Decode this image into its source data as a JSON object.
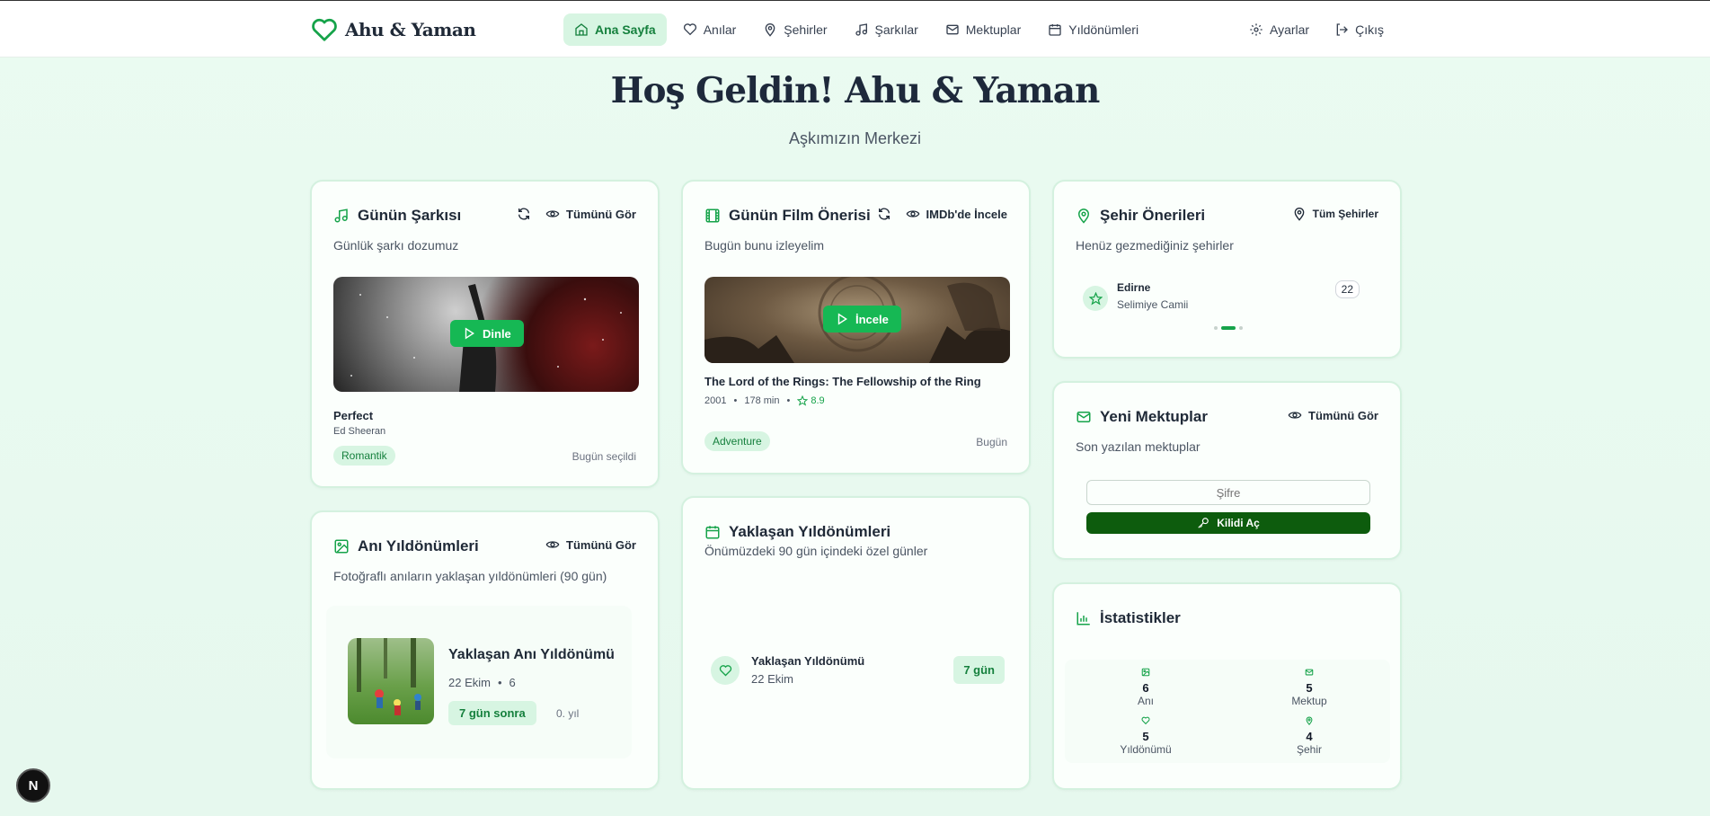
{
  "brand": {
    "name": "Ahu & Yaman",
    "icon": "heart-icon"
  },
  "nav": {
    "links": [
      {
        "label": "Ana Sayfa",
        "icon": "home-icon",
        "active": true
      },
      {
        "label": "Anılar",
        "icon": "heart-icon"
      },
      {
        "label": "Şehirler",
        "icon": "map-pin-icon"
      },
      {
        "label": "Şarkılar",
        "icon": "music-icon"
      },
      {
        "label": "Mektuplar",
        "icon": "mail-icon"
      },
      {
        "label": "Yıldönümleri",
        "icon": "calendar-icon"
      }
    ],
    "settings": "Ayarlar",
    "logout": "Çıkış"
  },
  "hero": {
    "title": "Hoş Geldin! Ahu & Yaman",
    "subtitle": "Aşkımızın Merkezi"
  },
  "song": {
    "title": "Günün Şarkısı",
    "subtitle": "Günlük şarkı dozumuz",
    "view_all": "Tümünü Gör",
    "play": "Dinle",
    "name": "Perfect",
    "artist": "Ed Sheeran",
    "tag": "Romantik",
    "selected": "Bugün seçildi"
  },
  "film": {
    "title": "Günün Film Önerisi",
    "subtitle": "Bugün bunu izleyelim",
    "imdb": "IMDb'de İncele",
    "play": "İncele",
    "name": "The Lord of the Rings: The Fellowship of the Ring",
    "year": "2001",
    "duration": "178 min",
    "rating": "8.9",
    "tag": "Adventure",
    "when": "Bugün"
  },
  "city": {
    "title": "Şehir Önerileri",
    "subtitle": "Henüz gezmediğiniz şehirler",
    "all": "Tüm Şehirler",
    "name": "Edirne",
    "place": "Selimiye Camii",
    "plate": "22"
  },
  "letters": {
    "title": "Yeni Mektuplar",
    "subtitle": "Son yazılan mektuplar",
    "view_all": "Tümünü Gör",
    "password_placeholder": "Şifre",
    "unlock": "Kilidi Aç"
  },
  "memory": {
    "title": "Anı Yıldönümleri",
    "subtitle": "Fotoğraflı anıların yaklaşan yıldönümleri (90 gün)",
    "view_all": "Tümünü Gör",
    "item_title": "Yaklaşan Anı Yıldönümü",
    "date": "22 Ekim",
    "count": "6",
    "badge": "7 gün sonra",
    "years": "0. yıl"
  },
  "anniversaries": {
    "title": "Yaklaşan Yıldönümleri",
    "subtitle": "Önümüzdeki 90 gün içindeki özel günler",
    "item_title": "Yaklaşan Yıldönümü",
    "date": "22 Ekim",
    "badge": "7 gün"
  },
  "stats": {
    "title": "İstatistikler",
    "items": [
      {
        "value": "6",
        "label": "Anı",
        "icon": "image-icon"
      },
      {
        "value": "5",
        "label": "Mektup",
        "icon": "mail-icon"
      },
      {
        "value": "5",
        "label": "Yıldönümü",
        "icon": "heart-icon"
      },
      {
        "value": "4",
        "label": "Şehir",
        "icon": "map-pin-icon"
      }
    ]
  },
  "dev_badge": "N",
  "colors": {
    "accent": "#16b854",
    "accent_dark": "#0d5c0d",
    "accent_bg": "#d7f5e2",
    "page_bg": "#e8faef"
  }
}
